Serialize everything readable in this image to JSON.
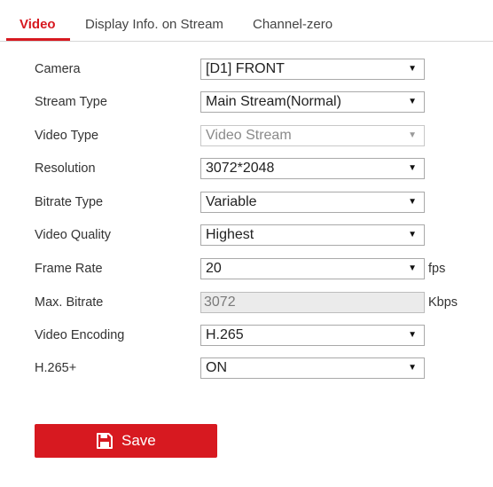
{
  "tabs": [
    {
      "label": "Video",
      "active": true
    },
    {
      "label": "Display Info. on Stream",
      "active": false
    },
    {
      "label": "Channel-zero",
      "active": false
    }
  ],
  "form": {
    "camera": {
      "label": "Camera",
      "value": "[D1] FRONT"
    },
    "stream_type": {
      "label": "Stream Type",
      "value": "Main Stream(Normal)"
    },
    "video_type": {
      "label": "Video Type",
      "value": "Video Stream",
      "disabled": true
    },
    "resolution": {
      "label": "Resolution",
      "value": "3072*2048"
    },
    "bitrate_type": {
      "label": "Bitrate Type",
      "value": "Variable"
    },
    "video_quality": {
      "label": "Video Quality",
      "value": "Highest"
    },
    "frame_rate": {
      "label": "Frame Rate",
      "value": "20",
      "unit": "fps"
    },
    "max_bitrate": {
      "label": "Max. Bitrate",
      "value": "3072",
      "unit": "Kbps",
      "readonly": true
    },
    "video_encoding": {
      "label": "Video Encoding",
      "value": "H.265"
    },
    "h265_plus": {
      "label": "H.265+",
      "value": "ON"
    }
  },
  "save_button": {
    "label": "Save",
    "icon": "floppy-disk-icon"
  },
  "colors": {
    "accent": "#d71920"
  }
}
